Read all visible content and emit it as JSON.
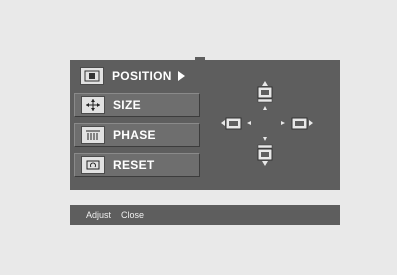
{
  "menu": {
    "items": [
      {
        "label": "POSITION",
        "icon": "position-icon",
        "selected": true
      },
      {
        "label": "SIZE",
        "icon": "size-icon",
        "selected": false
      },
      {
        "label": "PHASE",
        "icon": "phase-icon",
        "selected": false
      },
      {
        "label": "RESET",
        "icon": "reset-icon",
        "selected": false
      }
    ]
  },
  "help": {
    "adjust": "Adjust",
    "close": "Close"
  },
  "colors": {
    "panel": "#5e5e5e",
    "item": "#6e6e6e",
    "background": "#e9e9e9",
    "text": "#ffffff"
  }
}
